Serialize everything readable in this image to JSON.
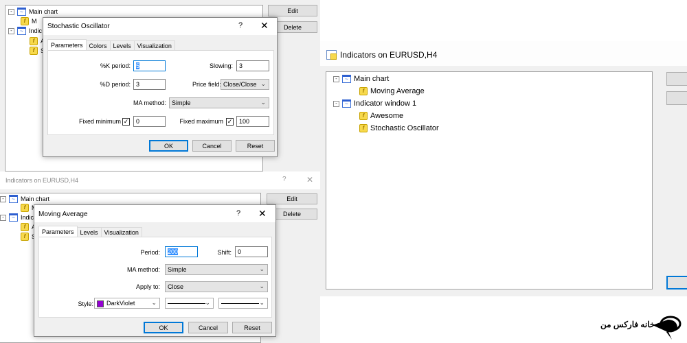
{
  "top_window": {
    "tree": [
      "Main chart",
      "M",
      "Indic",
      "A",
      "S"
    ],
    "edit_label": "Edit",
    "delete_label": "Delete"
  },
  "stochastic_dialog": {
    "title": "Stochastic Oscillator",
    "help": "?",
    "close": "✕",
    "tabs": [
      "Parameters",
      "Colors",
      "Levels",
      "Visualization"
    ],
    "k_period_label": "%K period:",
    "k_period": "5",
    "slowing_label": "Slowing:",
    "slowing": "3",
    "d_period_label": "%D period:",
    "d_period": "3",
    "price_field_label": "Price field:",
    "price_field": "Close/Close",
    "ma_method_label": "MA method:",
    "ma_method": "Simple",
    "fixed_min_label": "Fixed minimum",
    "fixed_min_checked": true,
    "fixed_min": "0",
    "fixed_max_label": "Fixed maximum",
    "fixed_max_checked": true,
    "fixed_max": "100",
    "ok": "OK",
    "cancel": "Cancel",
    "reset": "Reset"
  },
  "bottom_window": {
    "title": "Indicators on EURUSD,H4",
    "help": "?",
    "close": "✕",
    "tree": [
      "Main chart",
      "M",
      "Indic",
      "A",
      "S"
    ],
    "edit_label": "Edit",
    "delete_label": "Delete"
  },
  "ma_dialog": {
    "title": "Moving Average",
    "help": "?",
    "close": "✕",
    "tabs": [
      "Parameters",
      "Levels",
      "Visualization"
    ],
    "period_label": "Period:",
    "period": "200",
    "shift_label": "Shift:",
    "shift": "0",
    "ma_method_label": "MA method:",
    "ma_method": "Simple",
    "apply_to_label": "Apply to:",
    "apply_to": "Close",
    "style_label": "Style:",
    "color": "DarkViolet",
    "color_hex": "#9400d3",
    "ok": "OK",
    "cancel": "Cancel",
    "reset": "Reset"
  },
  "right_window": {
    "title": "Indicators on EURUSD,H4",
    "tree": [
      {
        "label": "Main chart",
        "type": "window"
      },
      {
        "label": "Moving Average",
        "type": "indicator"
      },
      {
        "label": "Indicator window 1",
        "type": "window"
      },
      {
        "label": "Awesome",
        "type": "indicator"
      },
      {
        "label": "Stochastic Oscillator",
        "type": "indicator"
      }
    ]
  },
  "logo": {
    "text": "خانه فارکس من"
  }
}
